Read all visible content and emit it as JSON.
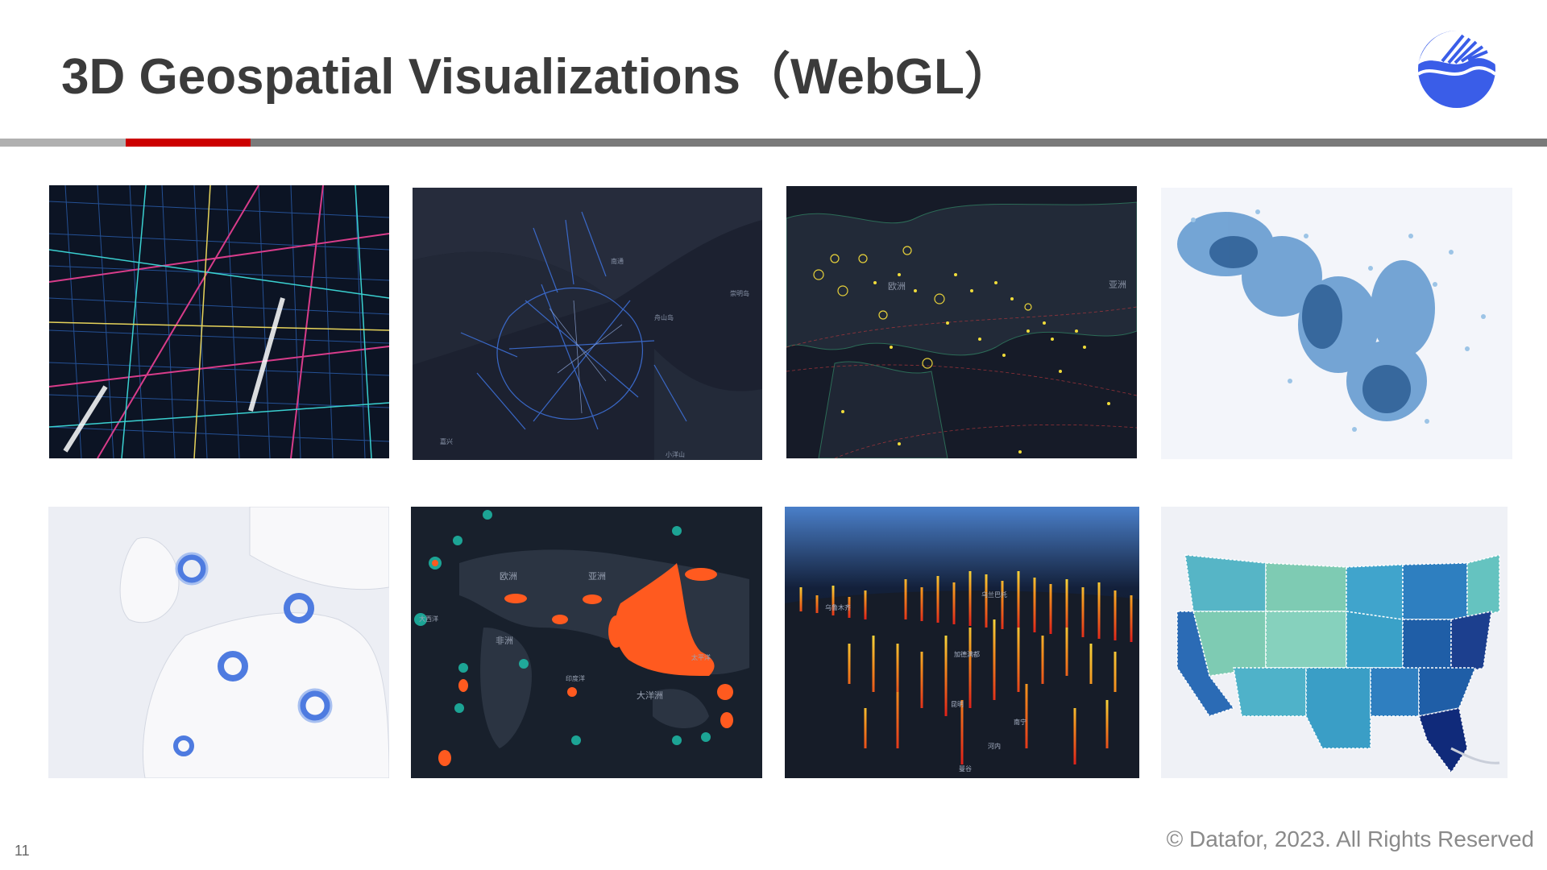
{
  "slide": {
    "title": "3D Geospatial Visualizations（WebGL）",
    "page_number": "11",
    "copyright": "© Datafor, 2023. All Rights Reserved"
  },
  "colors": {
    "accent_red": "#cc0000",
    "rule_gray": "#7a7a7a",
    "logo_blue": "#3a5de8",
    "dark_map_bg": "#1c2130",
    "light_map_bg": "#eceef4"
  },
  "logo": {
    "icon": "datafor-logo-icon"
  },
  "thumbnails": [
    {
      "icon": "city-road-network-map"
    },
    {
      "icon": "shanghai-transit-network-map",
      "labels": {
        "l1": "南通",
        "l2": "崇明岛",
        "l3": "舟山岛",
        "l4": "嘉兴",
        "l5": "小洋山"
      }
    },
    {
      "icon": "flight-routes-map",
      "labels": {
        "europe": "欧洲",
        "asia": "亚洲"
      }
    },
    {
      "icon": "scatter-density-map"
    },
    {
      "icon": "donut-markers-europe-map"
    },
    {
      "icon": "world-heatmap",
      "labels": {
        "europe": "欧洲",
        "asia": "亚洲",
        "africa": "非洲",
        "indian_ocean": "印度洋",
        "oceania": "大洋洲",
        "atlantic": "大西洋",
        "pacific": "太平洋"
      }
    },
    {
      "icon": "3d-bar-map",
      "labels": {
        "urumqi": "乌鲁木齐",
        "ulaanbaatar": "乌兰巴托",
        "kunming": "昆明",
        "hanoi": "河内",
        "bangkok": "曼谷",
        "kathmandu": "加德满都",
        "nanning": "南宁"
      }
    },
    {
      "icon": "us-choropleth-map"
    }
  ]
}
